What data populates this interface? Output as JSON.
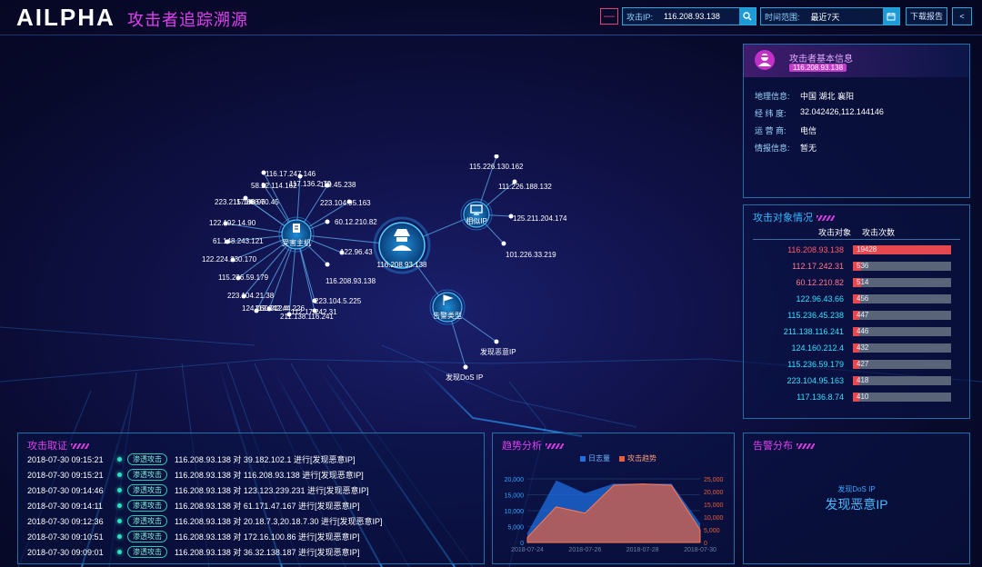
{
  "header": {
    "logo": "AILPHA",
    "title": "攻击者追踪溯源",
    "minus_label": "—",
    "ip_label": "攻击IP:",
    "ip_value": "116.208.93.138",
    "time_label": "时间范围:",
    "time_value": "最近7天",
    "download_label": "下载报告",
    "back_label": "<"
  },
  "graph": {
    "center": "116.208.93.138",
    "hub_victim": "受害主机",
    "hub_similar": "相似IP",
    "hub_alert": "告警类型",
    "victim_leaves": [
      "116.17.247.146",
      "58.22.114.162",
      "117.136.2.79",
      "110.45.238",
      "223.215.160.96",
      "171.88.70.45",
      "223.104.95.163",
      "122.192.14.90",
      "60.12.210.82",
      "61.148.243.121",
      "122.96.43",
      "122.224.230.170",
      "116.208.93.138",
      "115.236.59.179",
      "223.104.5.225",
      "223.104.21.38",
      "124.160.212.4",
      "112.17.242.31",
      "119.242.44.226",
      "211.138.116.241"
    ],
    "similar_leaves": [
      "115.226.130.162",
      "111.226.188.132",
      "125.211.204.174",
      "101.226.33.219"
    ],
    "alert_leaves": [
      "发现恶意IP",
      "发现DoS IP"
    ]
  },
  "attacker": {
    "title": "攻击者基本信息",
    "ip": "116.208.93.138",
    "rows": [
      {
        "k": "地理信息:",
        "v": "中国 湖北 襄阳"
      },
      {
        "k": "经 纬 度:",
        "v": "32.042426,112.144146"
      },
      {
        "k": "运 营 商:",
        "v": "电信"
      },
      {
        "k": "情报信息:",
        "v": "暂无"
      }
    ]
  },
  "targets": {
    "title": "攻击对象情况",
    "col1": "攻击对象",
    "col2": "攻击次数",
    "rows": [
      {
        "ip": "116.208.93.138",
        "count": "19428",
        "v": 19428
      },
      {
        "ip": "112.17.242.31",
        "count": "536",
        "v": 536
      },
      {
        "ip": "60.12.210.82",
        "count": "514",
        "v": 514
      },
      {
        "ip": "122.96.43.66",
        "count": "456",
        "v": 456
      },
      {
        "ip": "115.236.45.238",
        "count": "447",
        "v": 447
      },
      {
        "ip": "211.138.116.241",
        "count": "446",
        "v": 446
      },
      {
        "ip": "124.160.212.4",
        "count": "432",
        "v": 432
      },
      {
        "ip": "115.236.59.179",
        "count": "427",
        "v": 427
      },
      {
        "ip": "223.104.95.163",
        "count": "418",
        "v": 418
      },
      {
        "ip": "117.136.8.74",
        "count": "410",
        "v": 410
      }
    ]
  },
  "evidence": {
    "title": "攻击取证",
    "rows": [
      {
        "t": "2018-07-30 09:15:21",
        "tag": "渗透攻击",
        "txt": "116.208.93.138 对 39.182.102.1 进行[发现恶意IP]"
      },
      {
        "t": "2018-07-30 09:15:21",
        "tag": "渗透攻击",
        "txt": "116.208.93.138 对 116.208.93.138 进行[发现恶意IP]"
      },
      {
        "t": "2018-07-30 09:14:46",
        "tag": "渗透攻击",
        "txt": "116.208.93.138 对 123.123.239.231 进行[发现恶意IP]"
      },
      {
        "t": "2018-07-30 09:14:11",
        "tag": "渗透攻击",
        "txt": "116.208.93.138 对 61.171.47.167 进行[发现恶意IP]"
      },
      {
        "t": "2018-07-30 09:12:36",
        "tag": "渗透攻击",
        "txt": "116.208.93.138 对 20.18.7.3,20.18.7.30 进行[发现恶意IP]"
      },
      {
        "t": "2018-07-30 09:10:51",
        "tag": "渗透攻击",
        "txt": "116.208.93.138 对 172.16.100.86 进行[发现恶意IP]"
      },
      {
        "t": "2018-07-30 09:09:01",
        "tag": "渗透攻击",
        "txt": "116.208.93.138 对 36.32.138.187 进行[发现恶意IP]"
      }
    ]
  },
  "trend": {
    "title": "趋势分析",
    "legend1": "日志量",
    "legend2": "攻击趋势",
    "color1": "#1e6fe0",
    "color2": "#e8603a"
  },
  "chart_data": {
    "type": "area",
    "x": [
      "2018-07-24",
      "2018-07-25",
      "2018-07-26",
      "2018-07-27",
      "2018-07-28",
      "2018-07-29",
      "2018-07-30"
    ],
    "xticks": [
      "2018-07-24",
      "2018-07-26",
      "2018-07-28",
      "2018-07-30"
    ],
    "series": [
      {
        "name": "日志量",
        "axis": "left",
        "values": [
          3000,
          19500,
          15500,
          18500,
          18500,
          18500,
          6000
        ]
      },
      {
        "name": "攻击趋势",
        "axis": "right",
        "values": [
          2000,
          14000,
          11500,
          22500,
          23000,
          22500,
          5000
        ]
      }
    ],
    "yleft_ticks": [
      "20,000",
      "15,000",
      "10,000",
      "5,000",
      "0"
    ],
    "yright_ticks": [
      "25,000",
      "20,000",
      "15,000",
      "10,000",
      "5,000",
      "0"
    ],
    "ylim_left": [
      0,
      20000
    ],
    "ylim_right": [
      0,
      25000
    ]
  },
  "alerts": {
    "title": "告警分布",
    "small": "发现DoS IP",
    "big": "发现恶意IP"
  }
}
